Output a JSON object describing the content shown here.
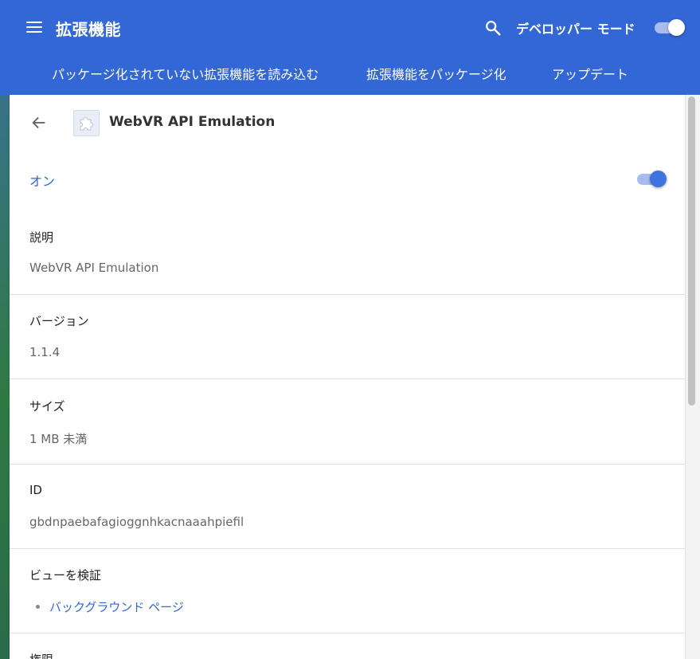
{
  "header": {
    "title": "拡張機能",
    "dev_mode_label": "デベロッパー モード",
    "dev_mode_on": true
  },
  "toolbar": {
    "load_unpacked": "パッケージ化されていない拡張機能を読み込む",
    "pack_extension": "拡張機能をパッケージ化",
    "update": "アップデート"
  },
  "extension": {
    "name": "WebVR API Emulation",
    "on_label": "オン",
    "enabled": true
  },
  "details": {
    "description_title": "説明",
    "description_value": "WebVR API Emulation",
    "version_title": "バージョン",
    "version_value": "1.1.4",
    "size_title": "サイズ",
    "size_value": "1 MB 未満",
    "id_title": "ID",
    "id_value": "gbdnpaebafagioggnhkacnaaahpiefil",
    "inspect_title": "ビューを検証",
    "background_page_link": "バックグラウンド ページ",
    "permissions_title": "権限"
  },
  "colors": {
    "header": "#3367d6",
    "accent": "#3367d6",
    "card": "#ffffff"
  },
  "icons": [
    "hamburger-menu-icon",
    "search-icon",
    "back-arrow-icon",
    "puzzle-piece-icon"
  ]
}
